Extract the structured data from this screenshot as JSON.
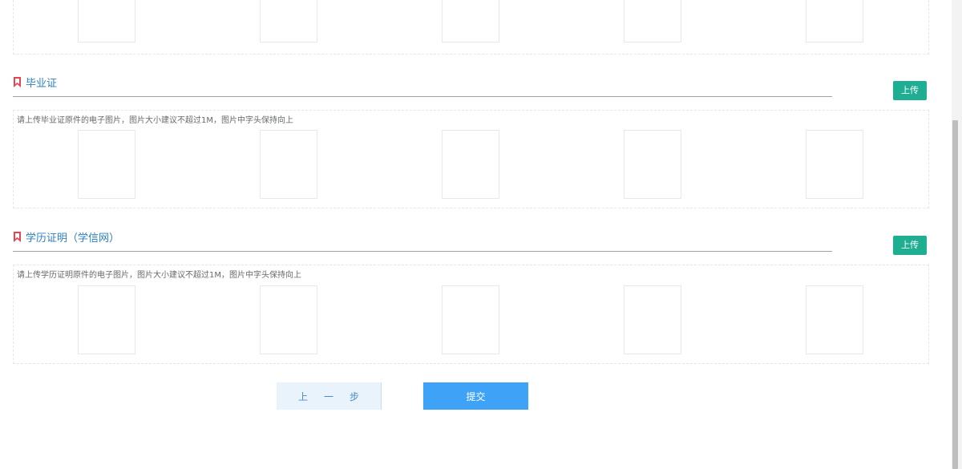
{
  "sections": [
    {
      "title": "毕业证",
      "upload_label": "上传",
      "hint": "请上传毕业证原件的电子图片，图片大小建议不超过1M，图片中字头保持向上"
    },
    {
      "title": "学历证明（学信网）",
      "upload_label": "上传",
      "hint": "请上传学历证明原件的电子图片，图片大小建议不超过1M，图片中字头保持向上"
    }
  ],
  "footer": {
    "prev_label": "上一步",
    "submit_label": "提交"
  },
  "colors": {
    "accent_blue": "#3ea3f7",
    "upload_green": "#1fae91",
    "title_blue": "#2d7fc1",
    "bookmark_red": "#e6454d"
  },
  "icons": {
    "section_marker": "bookmark-icon"
  }
}
